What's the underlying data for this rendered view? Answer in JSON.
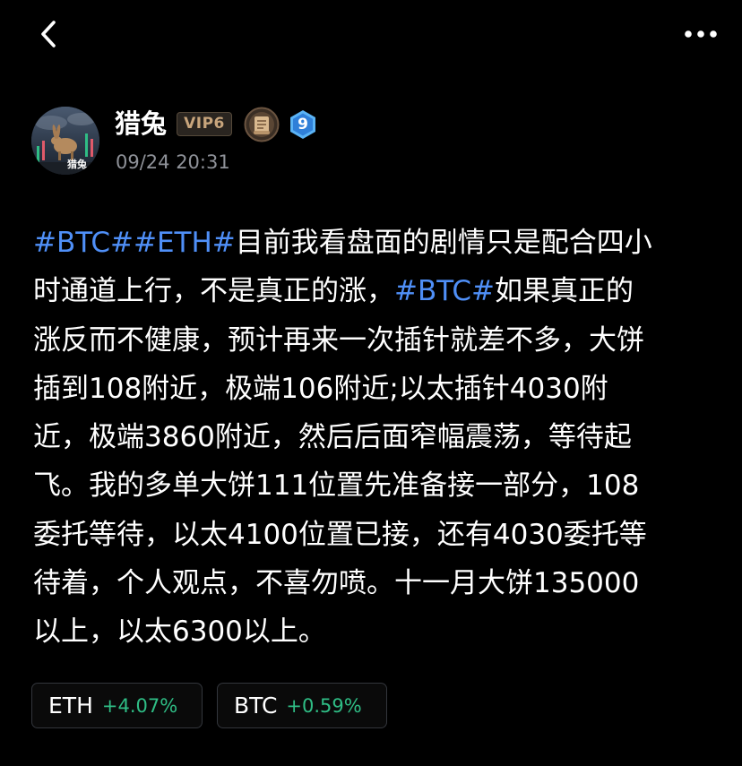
{
  "header": {
    "back_icon": "chevron-left-icon",
    "more_icon": "more-horizontal-icon"
  },
  "author": {
    "name": "猎兔",
    "avatar_text": "猎兔",
    "vip_label": "VIP6",
    "level_badge_icon": "scroll-badge-icon",
    "level_number": "9",
    "timestamp": "09/24 20:31"
  },
  "post": {
    "lines": [
      [
        {
          "t": "#BTC#",
          "tag": true
        },
        {
          "t": "#ETH#",
          "tag": true
        },
        {
          "t": "目前我看盘面的剧情只是配合四小",
          "tag": false
        }
      ],
      [
        {
          "t": "时通道上行，不是真正的涨，",
          "tag": false
        },
        {
          "t": "#BTC#",
          "tag": true
        },
        {
          "t": "如果真正的",
          "tag": false
        }
      ],
      [
        {
          "t": "涨反而不健康，预计再来一次插针就差不多，大饼",
          "tag": false
        }
      ],
      [
        {
          "t": "插到108附近，极端106附近;以太插针4030附",
          "tag": false
        }
      ],
      [
        {
          "t": "近，极端3860附近，然后后面窄幅震荡，等待起",
          "tag": false
        }
      ],
      [
        {
          "t": "飞。我的多单大饼111位置先准备接一部分，108",
          "tag": false
        }
      ],
      [
        {
          "t": "委托等待，以太4100位置已接，还有4030委托等",
          "tag": false
        }
      ],
      [
        {
          "t": "待着，个人观点，不喜勿喷。十一月大饼135000",
          "tag": false
        }
      ],
      [
        {
          "t": "以上，以太6300以上。",
          "tag": false
        }
      ]
    ]
  },
  "coins": [
    {
      "symbol": "ETH",
      "change": "+4.07%"
    },
    {
      "symbol": "BTC",
      "change": "+0.59%"
    }
  ],
  "colors": {
    "background": "#000000",
    "hashtag": "#4f8ff7",
    "positive": "#2fbd85",
    "timestamp": "#8f9299",
    "vip_text": "#c8a57c"
  }
}
